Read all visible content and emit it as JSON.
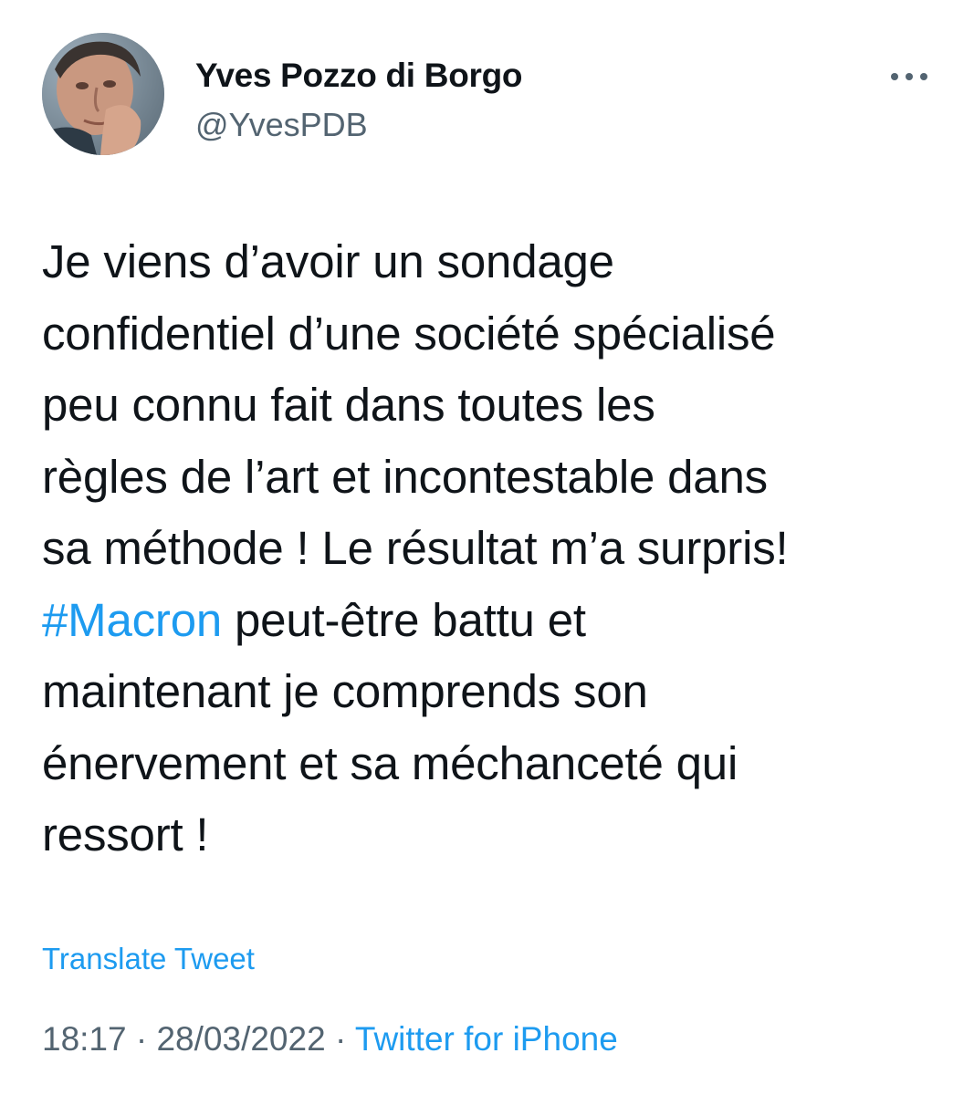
{
  "author": {
    "name": "Yves Pozzo di Borgo",
    "handle": "@YvesPDB",
    "avatar_icon": "profile-photo"
  },
  "more_icon": "more-horizontal-icon",
  "tweet": {
    "lines": [
      "Je viens d’avoir un sondage",
      "confidentiel d’une société spécialisé",
      "peu connu fait dans toutes les",
      "règles de l’art et incontestable dans",
      "sa méthode ! Le résultat m’a surpris!"
    ],
    "hashtag": "#Macron",
    "hashtag_line_rest": " peut-être battu et",
    "lines_after": [
      "maintenant je comprends son",
      "énervement et sa méchanceté qui",
      "ressort !"
    ]
  },
  "translate_label": "Translate Tweet",
  "meta": {
    "time": "18:17",
    "separator": " · ",
    "date": "28/03/2022",
    "source": "Twitter for iPhone"
  },
  "colors": {
    "link": "#1d9bf0",
    "text": "#0f1419",
    "secondary": "#536471"
  }
}
